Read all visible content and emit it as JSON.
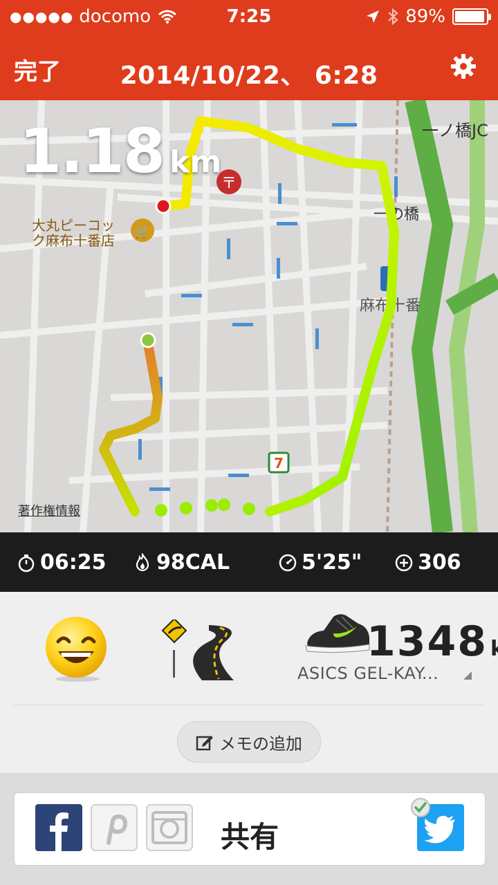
{
  "status_bar": {
    "signal": "●●●●●",
    "carrier": "docomo",
    "time": "7:25",
    "battery": "89%"
  },
  "nav": {
    "done_label": "完了",
    "title": "2014/10/22、 6:28"
  },
  "map": {
    "distance_value": "1.18",
    "distance_unit": "km",
    "copyright_label": "著作権情報",
    "labels": {
      "jct": "一ノ橋JC",
      "ichinohashi": "一の橋",
      "azabu": "麻布十番",
      "store_line1": "大丸ピーコッ",
      "store_line2": "ク麻布十番店"
    }
  },
  "stats": {
    "duration": "06:25",
    "calories": "98CAL",
    "pace": "5'25\"",
    "fuel": "306"
  },
  "details": {
    "shoe_distance_value": "1348",
    "shoe_distance_unit": "km",
    "shoe_name": "ASICS GEL-KAY...",
    "memo_label": "メモの追加"
  },
  "share": {
    "label": "共有"
  },
  "colors": {
    "header": "#de3c1c",
    "stats_bg": "#1c1c1c",
    "route_start": "#e2802a",
    "route_mid": "#ffef00",
    "route_end": "#8ef000",
    "twitter": "#1da1f2"
  }
}
